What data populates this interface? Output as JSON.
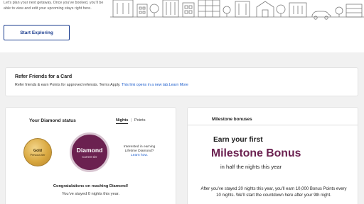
{
  "intro": {
    "text": "Let’s plan your next getaway. Once you’ve booked, you’ll be able to view and edit your upcoming stays right here.",
    "button": "Start Exploring"
  },
  "refer": {
    "title": "Refer Friends for a Card",
    "description": "Refer friends & earn Points for approved referrals. Terms Apply.",
    "link": "This link opens in a new tab.Learn More"
  },
  "status": {
    "title": "Your Diamond status",
    "toggle_nights": "Nights",
    "toggle_separator": "|",
    "toggle_points": "Points",
    "prev_tier_name": "Gold",
    "prev_tier_label": "Previous tier",
    "current_tier_name": "Diamond",
    "current_tier_label": "Current tier",
    "lifetime_line1": "Interested in earning",
    "lifetime_line2": "Lifetime Diamond?",
    "lifetime_link": "Learn how.",
    "congrats": "Congratulations on reaching Diamond!",
    "stayed": "You’ve stayed 0 nights this year."
  },
  "milestone": {
    "header": "Milestone bonuses",
    "earn": "Earn your first",
    "big": "Milestone Bonus",
    "half": "in half the nights this year",
    "body": "After you’ve stayed 20 nights this year, you’ll earn 10,000 Bonus Points every 10 nights. We’ll start the countdown here after your 9th night."
  },
  "colors": {
    "accent_blue": "#1b3d8f",
    "link_blue": "#1b5ccc",
    "diamond_plum": "#6b2150",
    "gold": "#d9a840"
  },
  "icons": {
    "carousel_prev": "chevron-left-icon",
    "illustration": "city-skyline-illustration"
  }
}
